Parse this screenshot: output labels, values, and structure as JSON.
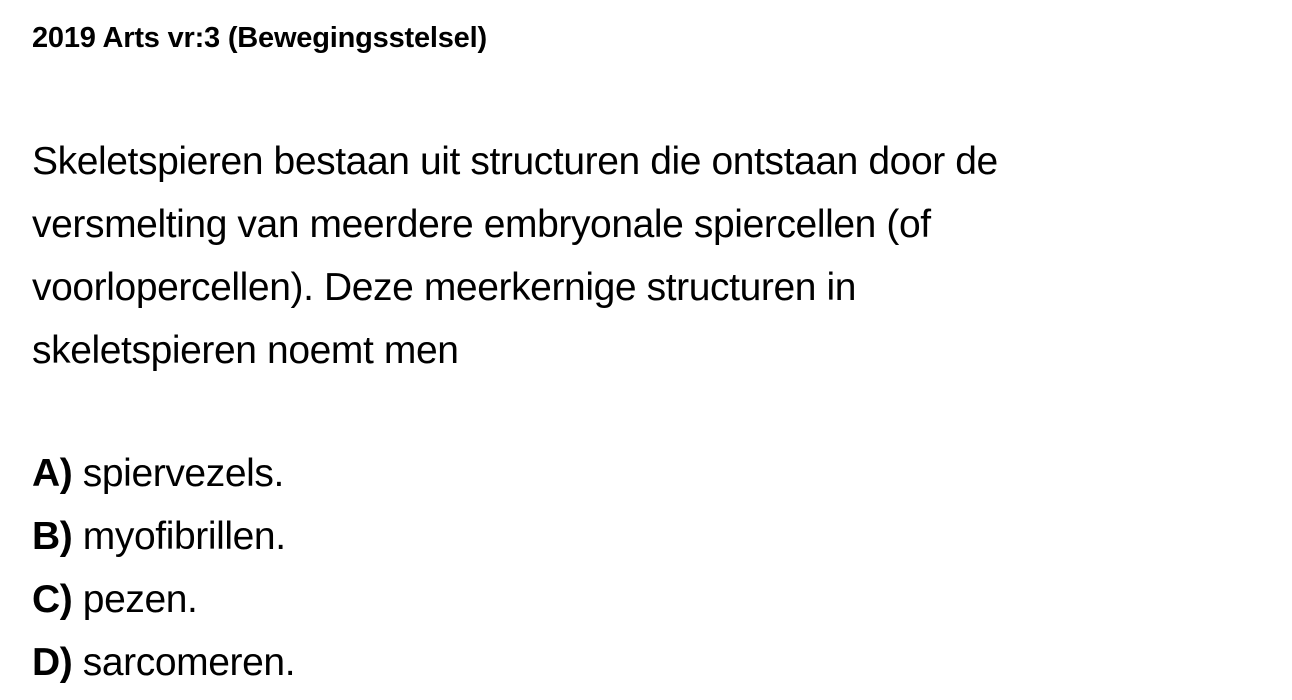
{
  "header": {
    "title": "2019 Arts vr:3 (Bewegingsstelsel)"
  },
  "question": {
    "lines": [
      "Skeletspieren bestaan uit structuren die ontstaan door de",
      "versmelting van meerdere embryonale spiercellen (of",
      "voorlopercellen). Deze meerkernige structuren in",
      "skeletspieren noemt men"
    ]
  },
  "options": [
    {
      "letter": "A)",
      "text": "spiervezels."
    },
    {
      "letter": "B)",
      "text": "myofibrillen."
    },
    {
      "letter": "C)",
      "text": "pezen."
    },
    {
      "letter": "D)",
      "text": "sarcomeren."
    }
  ]
}
